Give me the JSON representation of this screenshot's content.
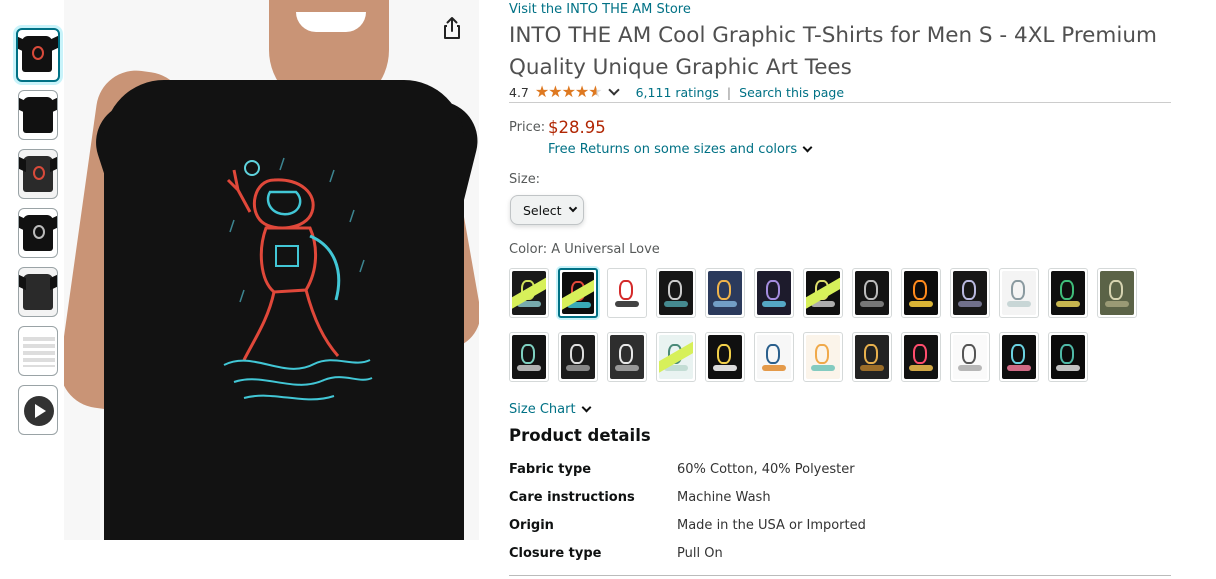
{
  "store_link": "Visit the INTO THE AM Store",
  "title": "INTO THE AM Cool Graphic T-Shirts for Men S - 4XL Premium Quality Unique Graphic Art Tees",
  "rating": {
    "value": "4.7",
    "stars": 4.7,
    "ratings_count": "6,111 ratings",
    "separator": "|",
    "search_link": "Search this page"
  },
  "price": {
    "label": "Price:",
    "value": "$28.95",
    "free_returns": "Free Returns on some sizes and colors"
  },
  "size": {
    "label": "Size:",
    "selected": "Select"
  },
  "color": {
    "label": "Color: A Universal Love",
    "selected_index": 1,
    "swatches": [
      {
        "bg": "#1a1a1a",
        "a": "#cfe15a",
        "b": "#88c4c8",
        "badge": true
      },
      {
        "bg": "#0d0d0d",
        "a": "#e0483a",
        "b": "#42c7d6",
        "badge": true
      },
      {
        "bg": "#ffffff",
        "a": "#d42a2a",
        "b": "#222222"
      },
      {
        "bg": "#161616",
        "a": "#cccccc",
        "b": "#4e9fa6"
      },
      {
        "bg": "#2b3a5c",
        "a": "#f0b44a",
        "b": "#7fb0d8"
      },
      {
        "bg": "#1d1b2c",
        "a": "#a58de0",
        "b": "#5fc0e0"
      },
      {
        "bg": "#101010",
        "a": "#dede6a",
        "b": "#c9c9c9",
        "badge": true
      },
      {
        "bg": "#141414",
        "a": "#bbbbbb",
        "b": "#888888"
      },
      {
        "bg": "#0c0c0c",
        "a": "#ff8a1c",
        "b": "#ffd23d"
      },
      {
        "bg": "#171717",
        "a": "#b9b9e0",
        "b": "#8080a0"
      },
      {
        "bg": "#f4f4f4",
        "a": "#8a9aa0",
        "b": "#c0d0d0"
      },
      {
        "bg": "#0f0f0f",
        "a": "#3fbd7a",
        "b": "#e8d45a"
      },
      {
        "bg": "#5b6347",
        "a": "#d6d3b0",
        "b": "#a6a37e"
      },
      {
        "bg": "#131313",
        "a": "#7fd0c0",
        "b": "#cccccc"
      },
      {
        "bg": "#1c1c1c",
        "a": "#dddddd",
        "b": "#9a9a9a"
      },
      {
        "bg": "#2e2e2e",
        "a": "#e8e8e8",
        "b": "#aaaaaa"
      },
      {
        "bg": "#e9f3f1",
        "a": "#4a8a78",
        "b": "#bcd8cf",
        "badge": true
      },
      {
        "bg": "#101010",
        "a": "#f2d04a",
        "b": "#ffffff"
      },
      {
        "bg": "#f7f7f7",
        "a": "#2a5f8c",
        "b": "#e08a2c"
      },
      {
        "bg": "#fbf4ea",
        "a": "#f0a94a",
        "b": "#6fc3b8"
      },
      {
        "bg": "#222222",
        "a": "#e7b04d",
        "b": "#b07a2a"
      },
      {
        "bg": "#111111",
        "a": "#ff4d6d",
        "b": "#f2c14e"
      },
      {
        "bg": "#fafafa",
        "a": "#555555",
        "b": "#aaaaaa"
      },
      {
        "bg": "#0e0e0e",
        "a": "#6ad1e0",
        "b": "#f27a9a"
      },
      {
        "bg": "#0b0b0b",
        "a": "#4fb8a6",
        "b": "#e2e2e2"
      }
    ]
  },
  "size_chart": "Size Chart",
  "product_details": {
    "heading": "Product details",
    "rows": [
      {
        "key": "Fabric type",
        "value": "60% Cotton, 40% Polyester"
      },
      {
        "key": "Care instructions",
        "value": "Machine Wash"
      },
      {
        "key": "Origin",
        "value": "Made in the USA or Imported"
      },
      {
        "key": "Closure type",
        "value": "Pull On"
      }
    ]
  },
  "thumbnails": [
    "front",
    "back",
    "detail",
    "model",
    "graphic",
    "size-chart",
    "video"
  ],
  "colors": {
    "link": "#007185",
    "price": "#b12704",
    "star": "#de7921"
  }
}
